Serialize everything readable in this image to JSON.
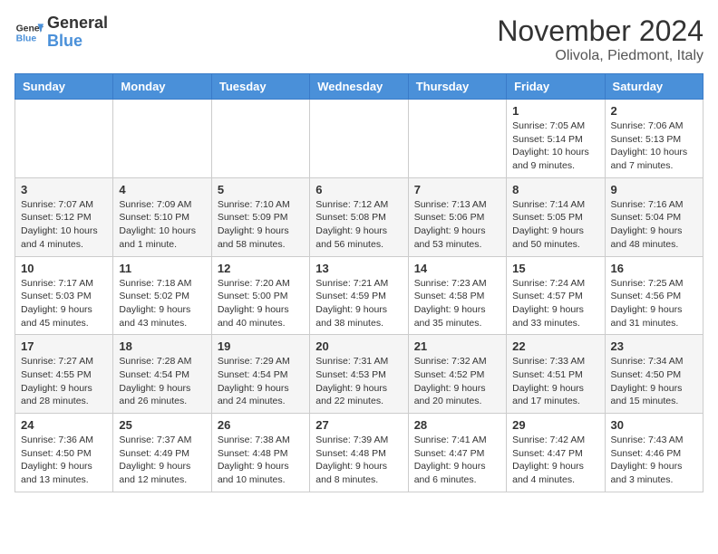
{
  "header": {
    "logo_line1": "General",
    "logo_line2": "Blue",
    "month_title": "November 2024",
    "location": "Olivola, Piedmont, Italy"
  },
  "days_of_week": [
    "Sunday",
    "Monday",
    "Tuesday",
    "Wednesday",
    "Thursday",
    "Friday",
    "Saturday"
  ],
  "weeks": [
    [
      {
        "day": "",
        "info": ""
      },
      {
        "day": "",
        "info": ""
      },
      {
        "day": "",
        "info": ""
      },
      {
        "day": "",
        "info": ""
      },
      {
        "day": "",
        "info": ""
      },
      {
        "day": "1",
        "info": "Sunrise: 7:05 AM\nSunset: 5:14 PM\nDaylight: 10 hours\nand 9 minutes."
      },
      {
        "day": "2",
        "info": "Sunrise: 7:06 AM\nSunset: 5:13 PM\nDaylight: 10 hours\nand 7 minutes."
      }
    ],
    [
      {
        "day": "3",
        "info": "Sunrise: 7:07 AM\nSunset: 5:12 PM\nDaylight: 10 hours\nand 4 minutes."
      },
      {
        "day": "4",
        "info": "Sunrise: 7:09 AM\nSunset: 5:10 PM\nDaylight: 10 hours\nand 1 minute."
      },
      {
        "day": "5",
        "info": "Sunrise: 7:10 AM\nSunset: 5:09 PM\nDaylight: 9 hours\nand 58 minutes."
      },
      {
        "day": "6",
        "info": "Sunrise: 7:12 AM\nSunset: 5:08 PM\nDaylight: 9 hours\nand 56 minutes."
      },
      {
        "day": "7",
        "info": "Sunrise: 7:13 AM\nSunset: 5:06 PM\nDaylight: 9 hours\nand 53 minutes."
      },
      {
        "day": "8",
        "info": "Sunrise: 7:14 AM\nSunset: 5:05 PM\nDaylight: 9 hours\nand 50 minutes."
      },
      {
        "day": "9",
        "info": "Sunrise: 7:16 AM\nSunset: 5:04 PM\nDaylight: 9 hours\nand 48 minutes."
      }
    ],
    [
      {
        "day": "10",
        "info": "Sunrise: 7:17 AM\nSunset: 5:03 PM\nDaylight: 9 hours\nand 45 minutes."
      },
      {
        "day": "11",
        "info": "Sunrise: 7:18 AM\nSunset: 5:02 PM\nDaylight: 9 hours\nand 43 minutes."
      },
      {
        "day": "12",
        "info": "Sunrise: 7:20 AM\nSunset: 5:00 PM\nDaylight: 9 hours\nand 40 minutes."
      },
      {
        "day": "13",
        "info": "Sunrise: 7:21 AM\nSunset: 4:59 PM\nDaylight: 9 hours\nand 38 minutes."
      },
      {
        "day": "14",
        "info": "Sunrise: 7:23 AM\nSunset: 4:58 PM\nDaylight: 9 hours\nand 35 minutes."
      },
      {
        "day": "15",
        "info": "Sunrise: 7:24 AM\nSunset: 4:57 PM\nDaylight: 9 hours\nand 33 minutes."
      },
      {
        "day": "16",
        "info": "Sunrise: 7:25 AM\nSunset: 4:56 PM\nDaylight: 9 hours\nand 31 minutes."
      }
    ],
    [
      {
        "day": "17",
        "info": "Sunrise: 7:27 AM\nSunset: 4:55 PM\nDaylight: 9 hours\nand 28 minutes."
      },
      {
        "day": "18",
        "info": "Sunrise: 7:28 AM\nSunset: 4:54 PM\nDaylight: 9 hours\nand 26 minutes."
      },
      {
        "day": "19",
        "info": "Sunrise: 7:29 AM\nSunset: 4:54 PM\nDaylight: 9 hours\nand 24 minutes."
      },
      {
        "day": "20",
        "info": "Sunrise: 7:31 AM\nSunset: 4:53 PM\nDaylight: 9 hours\nand 22 minutes."
      },
      {
        "day": "21",
        "info": "Sunrise: 7:32 AM\nSunset: 4:52 PM\nDaylight: 9 hours\nand 20 minutes."
      },
      {
        "day": "22",
        "info": "Sunrise: 7:33 AM\nSunset: 4:51 PM\nDaylight: 9 hours\nand 17 minutes."
      },
      {
        "day": "23",
        "info": "Sunrise: 7:34 AM\nSunset: 4:50 PM\nDaylight: 9 hours\nand 15 minutes."
      }
    ],
    [
      {
        "day": "24",
        "info": "Sunrise: 7:36 AM\nSunset: 4:50 PM\nDaylight: 9 hours\nand 13 minutes."
      },
      {
        "day": "25",
        "info": "Sunrise: 7:37 AM\nSunset: 4:49 PM\nDaylight: 9 hours\nand 12 minutes."
      },
      {
        "day": "26",
        "info": "Sunrise: 7:38 AM\nSunset: 4:48 PM\nDaylight: 9 hours\nand 10 minutes."
      },
      {
        "day": "27",
        "info": "Sunrise: 7:39 AM\nSunset: 4:48 PM\nDaylight: 9 hours\nand 8 minutes."
      },
      {
        "day": "28",
        "info": "Sunrise: 7:41 AM\nSunset: 4:47 PM\nDaylight: 9 hours\nand 6 minutes."
      },
      {
        "day": "29",
        "info": "Sunrise: 7:42 AM\nSunset: 4:47 PM\nDaylight: 9 hours\nand 4 minutes."
      },
      {
        "day": "30",
        "info": "Sunrise: 7:43 AM\nSunset: 4:46 PM\nDaylight: 9 hours\nand 3 minutes."
      }
    ]
  ]
}
